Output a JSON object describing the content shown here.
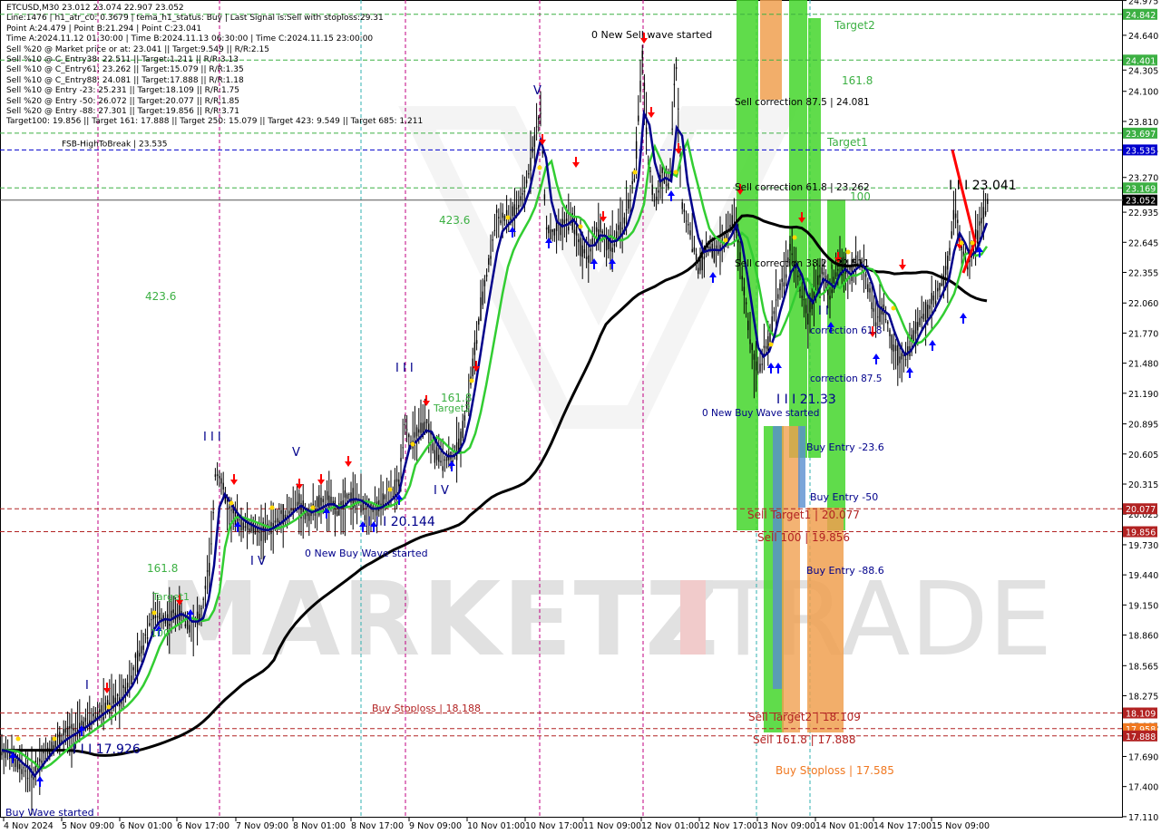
{
  "header": {
    "symbol_line": "ETCUSD,M30  23.012 23.074 22.907 23.052",
    "info_lines": [
      "Line:1476  |  h1_atr_c0: 0.3679  |  tema_h1_status: Buy  |  Last Signal is:Sell with stoploss:29.31",
      "Point A:24.479  |  Point B:21.294  |  Point C:23.041",
      "Time A:2024.11.12 01:30:00  |  Time B:2024.11.13 06:30:00  |  Time C:2024.11.15 23:00:00",
      "Sell %20 @ Market price or at: 23.041  ||  Target:9.549  ||  R/R:2.15",
      "Sell %10 @ C_Entry38: 22.511  ||  Target:1.211  ||  R/R:3.13",
      "Sell %10 @ C_Entry61: 23.262  ||  Target:15.079  ||  R/R:1.35",
      "Sell %10 @ C_Entry88: 24.081  ||  Target:17.888  ||  R/R:1.18",
      "Sell %10 @ Entry -23: 25.231  ||  Target:18.109  ||  R/R:1.75",
      "Sell %20 @ Entry -50: 26.072  ||  Target:20.077  ||  R/R:1.85",
      "Sell %20 @ Entry -88: 27.301  ||  Target:19.856  ||  R/R:3.71",
      "Target100: 19.856  ||  Target 161: 17.888  ||  Target 250: 15.079  ||  Target 423: 9.549  ||  Target 685: 1.211"
    ]
  },
  "colors": {
    "background": "#ffffff",
    "candle": "#000000",
    "ema_fast": "#00008b",
    "ema_mid": "#32cd32",
    "ema_slow": "#000000",
    "buy_arrow": "#0000ff",
    "sell_arrow": "#ff0000",
    "target_green": "#3cb043",
    "level_red": "#b22222",
    "blue_dashed": "#0000cd",
    "zone_green": "#44d62c",
    "zone_orange": "#f0a050",
    "zone_blue": "#5a8fd0",
    "watermark": "#c8c8c8",
    "watermark_accent": "#e6a0a0"
  },
  "watermark": {
    "left": "MARKETZ",
    "right": "TRADE"
  },
  "annotations": {
    "fsb_label": "FSB-HighToBreak  |  23.535",
    "new_sell_wave": "0 New Sell wave started",
    "new_buy_wave_1": "0 New Buy Wave started",
    "new_buy_wave_2": "0 New Buy Wave started",
    "buy_wave_started": "Buy Wave started",
    "target2": "Target2",
    "fib_161_top": "161.8",
    "target1": "Target1",
    "level_100_top": "100",
    "sell_corr_875": "Sell correction 87.5 | 24.081",
    "sell_corr_618": "Sell correction 61.8 | 23.262",
    "sell_corr_382": "Sell correction 38.2 | 22.511",
    "corr_618": "correction 61.8",
    "corr_875": "correction 87.5",
    "buy_entry_236": "Buy Entry -23.6",
    "buy_entry_50": "Buy Entry -50",
    "buy_entry_886": "Buy Entry -88.6",
    "sell_target1": "Sell Target1 | 20.077",
    "sell_100": "Sell 100 | 19.856",
    "sell_target2": "Sell Target2 | 18.109",
    "sell_1618": "Sell 161.8 | 17.888",
    "buy_stoploss_1": "Buy Stoploss | 18.188",
    "buy_stoploss_2": "Buy Stoploss | 17.585",
    "price_2104": "I I I 21.33",
    "price_23041": "I I I 23.041",
    "price_20144": "I I I 20.144",
    "price_17926": "I I I 17.926",
    "fib_4236_a": "423.6",
    "fib_4236_b": "423.6",
    "fib_1618_a": "161.8",
    "fib_1618_b": "161.8",
    "target2_b": "Target2",
    "fib_100_b": "100",
    "target1_b": "Target1",
    "wave_III_a": "I I I",
    "wave_III_b": "I I I",
    "wave_V_a": "V",
    "wave_V_b": "V",
    "wave_IV_a": "I V",
    "wave_IV_b": "I V",
    "wave_I": "I",
    "wave_I_I": "I I"
  },
  "chart_data": {
    "type": "candlestick",
    "symbol": "ETCUSD",
    "timeframe": "M30",
    "y_axis": {
      "min": 17.1,
      "max": 24.98,
      "ticks": [
        "24.975",
        "24.640",
        "24.305",
        "24.100",
        "23.810",
        "23.535",
        "23.270",
        "22.935",
        "22.645",
        "22.355",
        "22.060",
        "21.770",
        "21.480",
        "21.190",
        "20.895",
        "20.605",
        "20.315",
        "20.025",
        "19.730",
        "19.440",
        "19.150",
        "18.860",
        "18.565",
        "18.275",
        "17.985",
        "17.690",
        "17.400",
        "17.110"
      ]
    },
    "x_axis": {
      "labels": [
        "4 Nov 2024",
        "5 Nov 09:00",
        "6 Nov 01:00",
        "6 Nov 17:00",
        "7 Nov 09:00",
        "8 Nov 01:00",
        "8 Nov 17:00",
        "9 Nov 09:00",
        "10 Nov 01:00",
        "10 Nov 17:00",
        "11 Nov 09:00",
        "12 Nov 01:00",
        "12 Nov 17:00",
        "13 Nov 09:00",
        "14 Nov 01:00",
        "14 Nov 17:00",
        "15 Nov 09:00"
      ]
    },
    "ohlc_last": {
      "open": 23.012,
      "high": 23.074,
      "low": 22.907,
      "close": 23.052
    },
    "price_boxes": [
      {
        "value": "24.842",
        "color": "#3cb043"
      },
      {
        "value": "24.401",
        "color": "#3cb043"
      },
      {
        "value": "23.697",
        "color": "#3cb043"
      },
      {
        "value": "23.535",
        "color": "#0000cd"
      },
      {
        "value": "23.169",
        "color": "#3cb043"
      },
      {
        "value": "23.052",
        "color": "#000000"
      },
      {
        "value": "20.077",
        "color": "#b22222"
      },
      {
        "value": "19.856",
        "color": "#b22222"
      },
      {
        "value": "18.109",
        "color": "#b22222"
      },
      {
        "value": "17.958",
        "color": "#f07820"
      },
      {
        "value": "17.888",
        "color": "#b22222"
      }
    ],
    "levels": [
      {
        "price": 24.842,
        "style": "dashed",
        "color": "#3cb043"
      },
      {
        "price": 24.401,
        "style": "dashed",
        "color": "#3cb043"
      },
      {
        "price": 23.697,
        "style": "dashed",
        "color": "#3cb043"
      },
      {
        "price": 23.535,
        "style": "dashed",
        "color": "#0000cd"
      },
      {
        "price": 23.169,
        "style": "dashed",
        "color": "#3cb043"
      },
      {
        "price": 23.052,
        "style": "solid",
        "color": "#555555"
      },
      {
        "price": 20.077,
        "style": "dashed",
        "color": "#b22222"
      },
      {
        "price": 19.856,
        "style": "dashed",
        "color": "#b22222"
      },
      {
        "price": 18.109,
        "style": "dashed",
        "color": "#b22222"
      },
      {
        "price": 17.958,
        "style": "dashed",
        "color": "#b22222"
      },
      {
        "price": 17.888,
        "style": "dashed",
        "color": "#b22222"
      }
    ],
    "path_points": [
      [
        0,
        17.75
      ],
      [
        10,
        17.72
      ],
      [
        20,
        17.6
      ],
      [
        30,
        17.55
      ],
      [
        35,
        17.45
      ],
      [
        40,
        17.6
      ],
      [
        48,
        17.7
      ],
      [
        58,
        17.8
      ],
      [
        70,
        17.88
      ],
      [
        85,
        17.95
      ],
      [
        100,
        18.05
      ],
      [
        115,
        18.15
      ],
      [
        130,
        18.25
      ],
      [
        145,
        18.45
      ],
      [
        155,
        18.7
      ],
      [
        165,
        19.0
      ],
      [
        175,
        19.05
      ],
      [
        185,
        19.0
      ],
      [
        195,
        19.1
      ],
      [
        210,
        18.95
      ],
      [
        222,
        19.05
      ],
      [
        232,
        19.6
      ],
      [
        238,
        20.5
      ],
      [
        245,
        20.3
      ],
      [
        252,
        20.05
      ],
      [
        262,
        19.95
      ],
      [
        275,
        19.9
      ],
      [
        290,
        19.85
      ],
      [
        305,
        19.95
      ],
      [
        318,
        20.05
      ],
      [
        328,
        20.15
      ],
      [
        338,
        20.0
      ],
      [
        350,
        20.1
      ],
      [
        362,
        20.15
      ],
      [
        372,
        20.05
      ],
      [
        383,
        20.2
      ],
      [
        395,
        20.15
      ],
      [
        407,
        20.05
      ],
      [
        418,
        20.1
      ],
      [
        430,
        20.2
      ],
      [
        440,
        20.3
      ],
      [
        446,
        20.95
      ],
      [
        452,
        20.7
      ],
      [
        460,
        20.8
      ],
      [
        470,
        20.9
      ],
      [
        480,
        20.6
      ],
      [
        490,
        20.55
      ],
      [
        500,
        20.6
      ],
      [
        508,
        20.75
      ],
      [
        515,
        21.1
      ],
      [
        522,
        21.5
      ],
      [
        530,
        22.0
      ],
      [
        538,
        22.4
      ],
      [
        548,
        22.9
      ],
      [
        558,
        22.85
      ],
      [
        568,
        22.95
      ],
      [
        578,
        23.1
      ],
      [
        588,
        23.6
      ],
      [
        596,
        23.9
      ],
      [
        602,
        22.8
      ],
      [
        610,
        22.7
      ],
      [
        620,
        22.8
      ],
      [
        630,
        22.9
      ],
      [
        640,
        22.6
      ],
      [
        650,
        22.55
      ],
      [
        660,
        22.8
      ],
      [
        670,
        22.6
      ],
      [
        680,
        22.7
      ],
      [
        690,
        22.9
      ],
      [
        700,
        23.3
      ],
      [
        708,
        24.45
      ],
      [
        715,
        23.4
      ],
      [
        722,
        23.0
      ],
      [
        730,
        23.3
      ],
      [
        738,
        23.2
      ],
      [
        745,
        24.45
      ],
      [
        752,
        23.0
      ],
      [
        760,
        22.8
      ],
      [
        770,
        22.4
      ],
      [
        780,
        22.6
      ],
      [
        790,
        22.55
      ],
      [
        800,
        22.7
      ],
      [
        810,
        22.9
      ],
      [
        818,
        22.3
      ],
      [
        826,
        21.8
      ],
      [
        833,
        21.4
      ],
      [
        840,
        21.5
      ],
      [
        848,
        21.7
      ],
      [
        856,
        22.1
      ],
      [
        864,
        22.3
      ],
      [
        872,
        22.6
      ],
      [
        880,
        22.3
      ],
      [
        890,
        21.9
      ],
      [
        898,
        22.2
      ],
      [
        906,
        22.4
      ],
      [
        915,
        22.1
      ],
      [
        925,
        22.5
      ],
      [
        935,
        22.3
      ],
      [
        945,
        22.5
      ],
      [
        955,
        22.3
      ],
      [
        965,
        21.9
      ],
      [
        975,
        22.0
      ],
      [
        985,
        21.6
      ],
      [
        995,
        21.5
      ],
      [
        1005,
        21.7
      ],
      [
        1015,
        21.9
      ],
      [
        1025,
        22.0
      ],
      [
        1035,
        22.2
      ],
      [
        1045,
        22.4
      ],
      [
        1052,
        23.0
      ],
      [
        1060,
        22.6
      ],
      [
        1068,
        22.4
      ],
      [
        1076,
        22.7
      ],
      [
        1084,
        22.9
      ],
      [
        1090,
        23.05
      ]
    ]
  }
}
